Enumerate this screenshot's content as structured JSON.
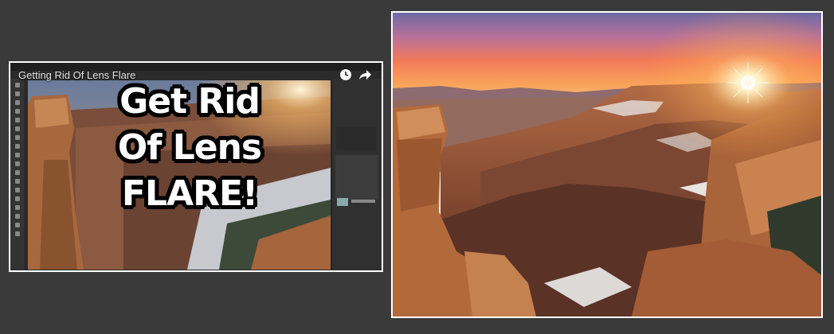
{
  "video": {
    "title": "Getting Rid Of Lens Flare",
    "overlay_lines": [
      "Get Rid",
      "Of Lens",
      "FLARE!"
    ],
    "icons": [
      "clock-icon",
      "share-icon"
    ]
  },
  "photo": {
    "subject": "grand-canyon-sunset-photo"
  },
  "colors": {
    "background": "#3a3a3a",
    "frame_border": "#ffffff",
    "overlay_text": "#ffffff",
    "overlay_outline": "#000000"
  }
}
